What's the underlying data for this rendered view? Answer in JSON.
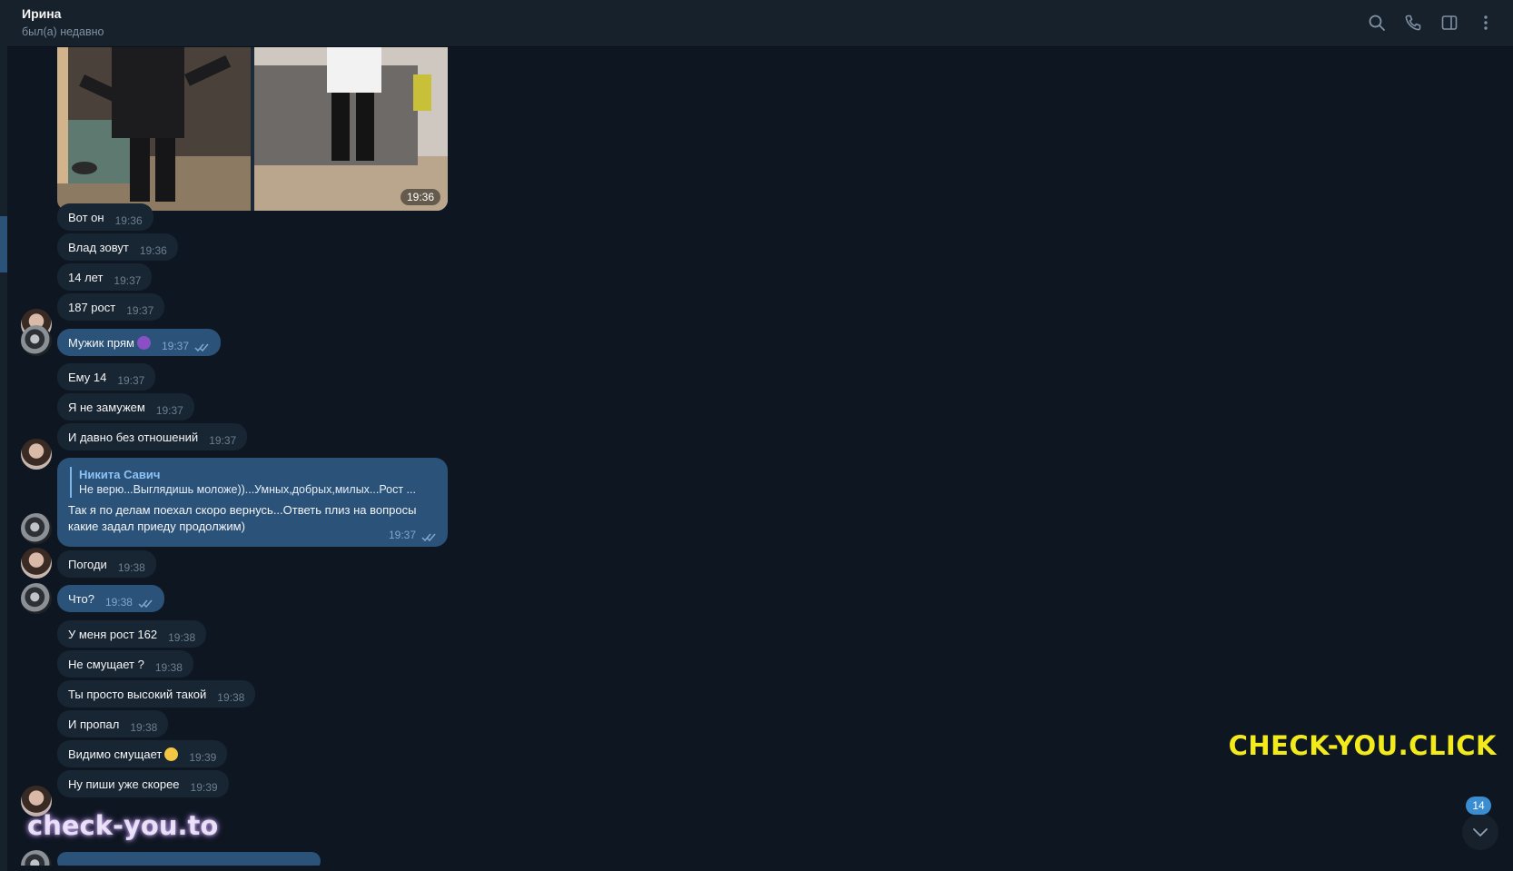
{
  "header": {
    "contact_name": "Ирина",
    "contact_status": "был(а) недавно",
    "icons": [
      "search-icon",
      "phone-icon",
      "sidebar-toggle-icon",
      "more-vertical-icon"
    ]
  },
  "album": {
    "time": "19:36"
  },
  "messages": [
    {
      "text": "Вот он",
      "time": "19:36"
    },
    {
      "text": "Влад зовут",
      "time": "19:36"
    },
    {
      "text": "14 лет",
      "time": "19:37"
    },
    {
      "text": "187 рост",
      "time": "19:37"
    },
    {
      "text": "Мужик прям",
      "time": "19:37"
    },
    {
      "text": "Ему 14",
      "time": "19:37"
    },
    {
      "text": "Я не замужем",
      "time": "19:37"
    },
    {
      "text": "И давно без отношений",
      "time": "19:37"
    },
    {
      "text": "Погоди",
      "time": "19:38"
    },
    {
      "text": "Что?",
      "time": "19:38"
    },
    {
      "text": "У меня рост 162",
      "time": "19:38"
    },
    {
      "text": "Не смущает ?",
      "time": "19:38"
    },
    {
      "text": "Ты просто высокий такой",
      "time": "19:38"
    },
    {
      "text": "И пропал",
      "time": "19:38"
    },
    {
      "text": "Видимо смущает",
      "time": "19:39"
    },
    {
      "text": "Ну пиши уже скорее",
      "time": "19:39"
    }
  ],
  "reply_message": {
    "author": "Никита Савич",
    "quoted": "Не верю...Выглядишь моложе))...Умных,добрых,милых...Рост ...",
    "text": "Так я по делам поехал скоро вернусь...Ответь плиз на вопросы какие задал приеду продолжим)",
    "time": "19:37"
  },
  "unread_count": "14",
  "watermarks": {
    "right": "CHECK-YOU.CLICK",
    "left": "check-you.to"
  },
  "colors": {
    "background": "#0e1621",
    "incoming_bubble": "#182533",
    "outgoing_bubble": "#2b5278",
    "accent": "#3a8dd0",
    "watermark_yellow": "#f3ea1c"
  }
}
